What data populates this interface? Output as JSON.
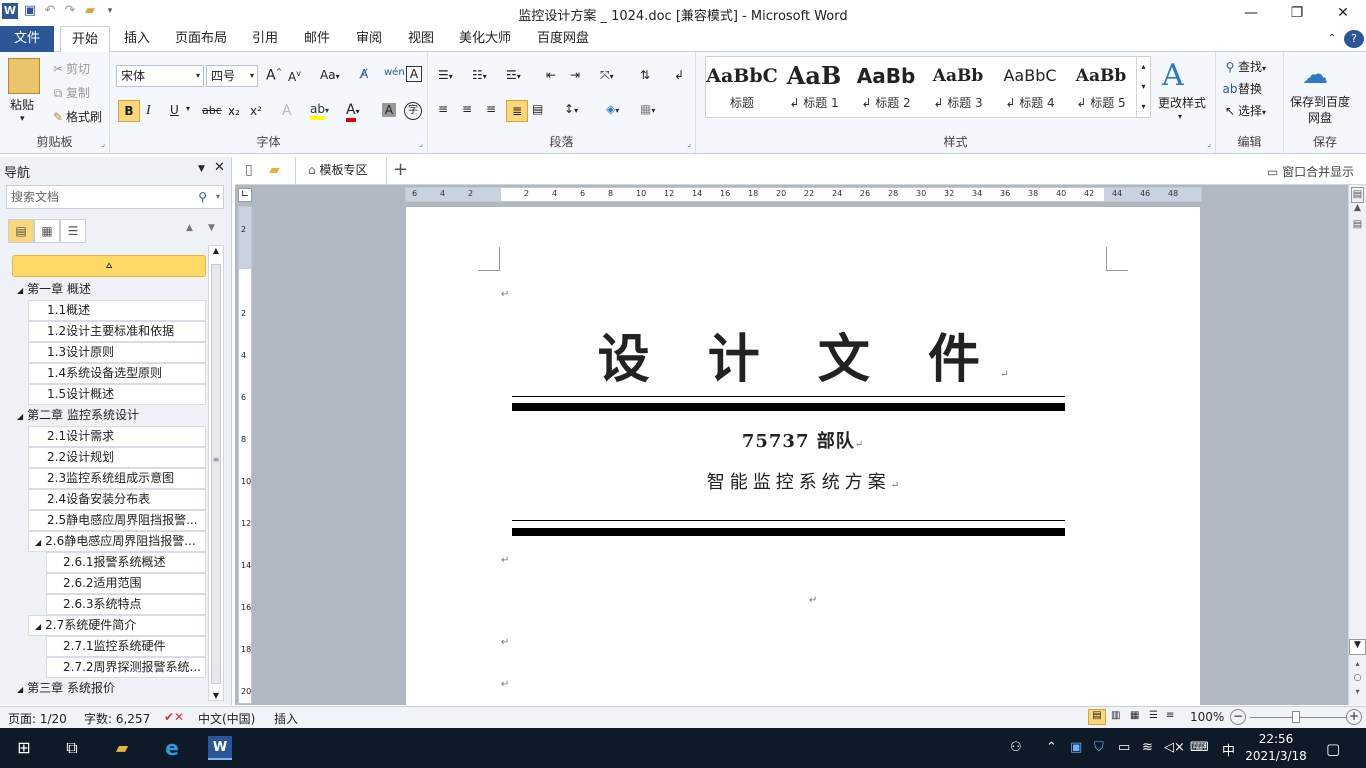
{
  "title_bar": {
    "document_title": "监控设计方案 _ 1024.doc [兼容模式] - Microsoft Word",
    "app_icon": "W",
    "quick_access": [
      "save-icon",
      "undo-icon",
      "redo-icon",
      "open-icon",
      "customize-icon"
    ],
    "window_buttons": {
      "minimize": "—",
      "restore": "❐",
      "close": "✕"
    }
  },
  "menu_tabs": {
    "file": "文件",
    "items": [
      "开始",
      "插入",
      "页面布局",
      "引用",
      "邮件",
      "审阅",
      "视图",
      "美化大师",
      "百度网盘"
    ],
    "active": "开始"
  },
  "ribbon": {
    "clipboard": {
      "group_label": "剪贴板",
      "paste": "粘贴",
      "cut": "剪切",
      "copy": "复制",
      "format_painter": "格式刷"
    },
    "font": {
      "group_label": "字体",
      "font_name": "宋体",
      "font_size": "四号",
      "grow": "A",
      "shrink": "A",
      "case": "Aa",
      "bold": "B",
      "italic": "I",
      "underline": "U",
      "strike": "abc",
      "subscript": "x₂",
      "superscript": "x²",
      "font_color": "A",
      "char_shading": "A",
      "encircle": "字"
    },
    "paragraph": {
      "group_label": "段落"
    },
    "styles": {
      "group_label": "样式",
      "items": [
        {
          "sample": "AaBbC",
          "name": "标题"
        },
        {
          "sample": "AaB",
          "name": "标题 1"
        },
        {
          "sample": "AaBb",
          "name": "标题 2"
        },
        {
          "sample": "AaBb",
          "name": "标题 3"
        },
        {
          "sample": "AaBbC",
          "name": "标题 4"
        },
        {
          "sample": "AaBb",
          "name": "标题 5"
        }
      ],
      "change_styles": "更改样式"
    },
    "editing": {
      "group_label": "编辑",
      "find": "查找",
      "replace": "替换",
      "select": "选择"
    },
    "save": {
      "group_label": "保存",
      "save_to_baidu": "保存到百度网盘"
    }
  },
  "navigation": {
    "title": "导航",
    "search_placeholder": "搜索文档",
    "items": [
      {
        "level": 1,
        "text": "第一章 概述"
      },
      {
        "level": 2,
        "text": "1.1概述"
      },
      {
        "level": 2,
        "text": "1.2设计主要标准和依据"
      },
      {
        "level": 2,
        "text": "1.3设计原则"
      },
      {
        "level": 2,
        "text": "1.4系统设备选型原则"
      },
      {
        "level": 2,
        "text": "1.5设计概述"
      },
      {
        "level": 1,
        "text": "第二章 监控系统设计"
      },
      {
        "level": 2,
        "text": "2.1设计需求"
      },
      {
        "level": 2,
        "text": "2.2设计规划"
      },
      {
        "level": 2,
        "text": "2.3监控系统组成示意图"
      },
      {
        "level": 2,
        "text": "2.4设备安装分布表"
      },
      {
        "level": 2,
        "text": "2.5静电感应周界阻挡报警..."
      },
      {
        "level": 2,
        "text": "2.6静电感应周界阻挡报警...",
        "expandable": true
      },
      {
        "level": 3,
        "text": "2.6.1报警系统概述"
      },
      {
        "level": 3,
        "text": "2.6.2适用范围"
      },
      {
        "level": 3,
        "text": "2.6.3系统特点"
      },
      {
        "level": 2,
        "text": "2.7系统硬件简介",
        "expandable": true
      },
      {
        "level": 3,
        "text": "2.7.1监控系统硬件"
      },
      {
        "level": 3,
        "text": "2.7.2周界探测报警系统..."
      },
      {
        "level": 1,
        "text": "第三章 系统报价"
      }
    ]
  },
  "doc_tabs": {
    "template_zone": "模板专区",
    "merge_window": "窗口合并显示"
  },
  "ruler": {
    "ticks": [
      "6",
      "4",
      "2",
      "",
      "2",
      "4",
      "6",
      "8",
      "10",
      "12",
      "14",
      "16",
      "18",
      "20",
      "22",
      "24",
      "26",
      "28",
      "30",
      "32",
      "34",
      "36",
      "38",
      "40",
      "42",
      "44",
      "46",
      "48"
    ],
    "vticks": [
      "2",
      "",
      "2",
      "4",
      "6",
      "8",
      "10",
      "12",
      "14",
      "16",
      "18",
      "20"
    ]
  },
  "document": {
    "title": "设 计 文 件",
    "unit": "75737 部队",
    "subtitle": "智能监控系统方案",
    "para_mark": "↵"
  },
  "status_bar": {
    "page": "页面: 1/20",
    "words": "字数: 6,257",
    "language": "中文(中国)",
    "mode": "插入",
    "zoom": "100%"
  },
  "taskbar": {
    "ime": "中",
    "time": "22:56",
    "date": "2021/3/18"
  }
}
